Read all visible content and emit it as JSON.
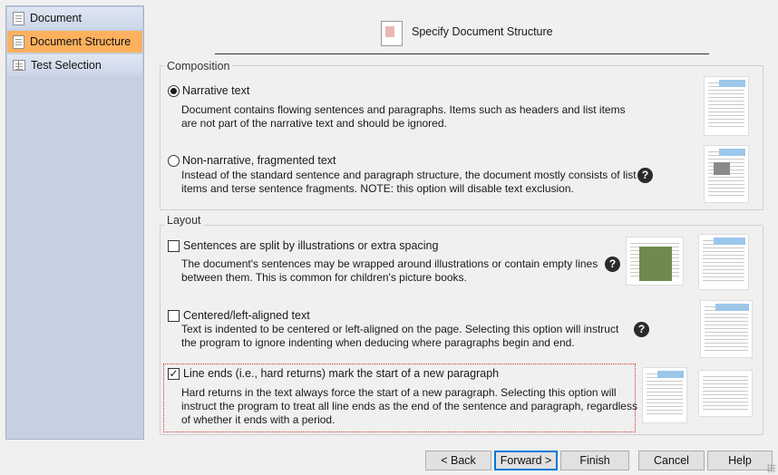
{
  "sidebar": {
    "items": [
      {
        "label": "Document",
        "icon": "document-icon",
        "active": false
      },
      {
        "label": "Document Structure",
        "icon": "document-structure-icon",
        "active": true
      },
      {
        "label": "Test Selection",
        "icon": "book-icon",
        "active": false
      }
    ],
    "active_color": "#fdb15f"
  },
  "header": {
    "title": "Specify Document Structure"
  },
  "composition": {
    "label": "Composition",
    "narrative": {
      "label": "Narrative text",
      "desc1": "Document contains flowing sentences and paragraphs. Items such as headers and list items",
      "desc2": "are not part of the narrative text and should be ignored.",
      "checked": true
    },
    "non_narrative": {
      "label": "Non-narrative, fragmented text",
      "desc1": "Instead of the standard sentence and paragraph structure, the document mostly consists of list",
      "desc2": "items and terse sentence fragments. NOTE: this option will disable text exclusion.",
      "checked": false
    }
  },
  "layout": {
    "label": "Layout",
    "split": {
      "label": "Sentences are split by illustrations or extra spacing",
      "desc1": "The document's sentences may be wrapped around illustrations or contain empty lines",
      "desc2": "between them. This is common for children's picture books.",
      "checked": false
    },
    "centered": {
      "label": "Centered/left-aligned text",
      "desc1": "Text is indented to be centered or left-aligned on the page. Selecting this option will instruct",
      "desc2": "the program to ignore indenting when deducing where paragraphs begin and end.",
      "checked": false
    },
    "line_ends": {
      "label": "Line ends (i.e., hard returns) mark the start of a new paragraph",
      "desc1": "Hard returns in the text always force the start of a new paragraph. Selecting this option will",
      "desc2": "instruct the program to treat all line ends as the end of the sentence and paragraph, regardless",
      "desc3": "of whether it ends with a period.",
      "checked": true
    }
  },
  "help_glyph": "?",
  "check_glyph": "✓",
  "buttons": {
    "back": "< Back",
    "forward": "Forward >",
    "finish": "Finish",
    "cancel": "Cancel",
    "help": "Help"
  }
}
